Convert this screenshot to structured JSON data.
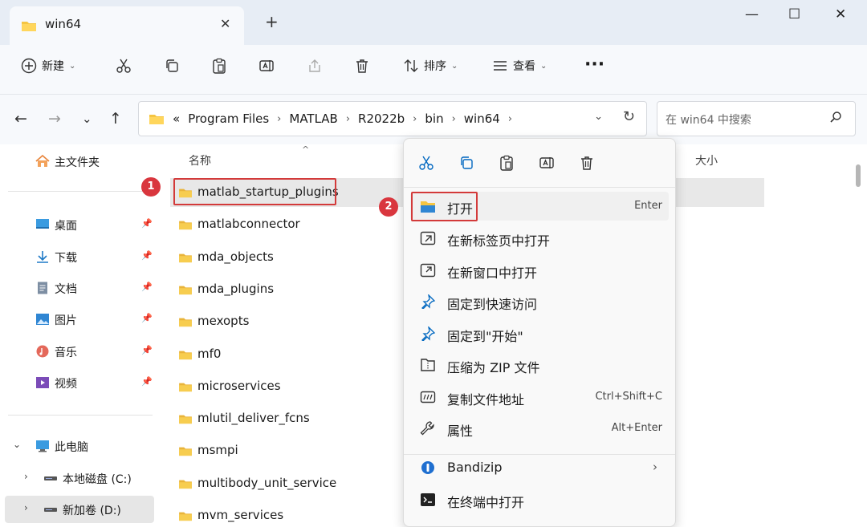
{
  "tab": {
    "title": "win64"
  },
  "toolbar": {
    "new_label": "新建",
    "sort_label": "排序",
    "view_label": "查看"
  },
  "address": {
    "overflow": "«",
    "segments": [
      "Program Files",
      "MATLAB",
      "R2022b",
      "bin",
      "win64"
    ]
  },
  "search": {
    "placeholder": "在 win64 中搜索"
  },
  "sidebar": {
    "home": "主文件夹",
    "quick": [
      {
        "label": "桌面",
        "icon": "desktop-icon"
      },
      {
        "label": "下载",
        "icon": "download-icon"
      },
      {
        "label": "文档",
        "icon": "document-icon"
      },
      {
        "label": "图片",
        "icon": "picture-icon"
      },
      {
        "label": "音乐",
        "icon": "music-icon"
      },
      {
        "label": "视频",
        "icon": "video-icon"
      }
    ],
    "this_pc": "此电脑",
    "drives": [
      "本地磁盘 (C:)",
      "新加卷 (D:)"
    ]
  },
  "columns": {
    "name": "名称",
    "size": "大小"
  },
  "files": [
    "matlab_startup_plugins",
    "matlabconnector",
    "mda_objects",
    "mda_plugins",
    "mexopts",
    "mf0",
    "microservices",
    "mlutil_deliver_fcns",
    "msmpi",
    "multibody_unit_service",
    "mvm_services"
  ],
  "badges": {
    "one": "1",
    "two": "2"
  },
  "context_menu": {
    "open": {
      "label": "打开",
      "shortcut": "Enter"
    },
    "items": [
      {
        "label": "在新标签页中打开",
        "shortcut": ""
      },
      {
        "label": "在新窗口中打开",
        "shortcut": ""
      },
      {
        "label": "固定到快速访问",
        "shortcut": ""
      },
      {
        "label": "固定到\"开始\"",
        "shortcut": ""
      },
      {
        "label": "压缩为 ZIP 文件",
        "shortcut": ""
      },
      {
        "label": "复制文件地址",
        "shortcut": "Ctrl+Shift+C"
      },
      {
        "label": "属性",
        "shortcut": "Alt+Enter"
      }
    ],
    "bandizip": "Bandizip",
    "terminal": "在终端中打开"
  },
  "colors": {
    "accent": "#0067c0",
    "folder": "#f5c542",
    "highlight": "#d33a3a",
    "badge": "#d9363e"
  }
}
